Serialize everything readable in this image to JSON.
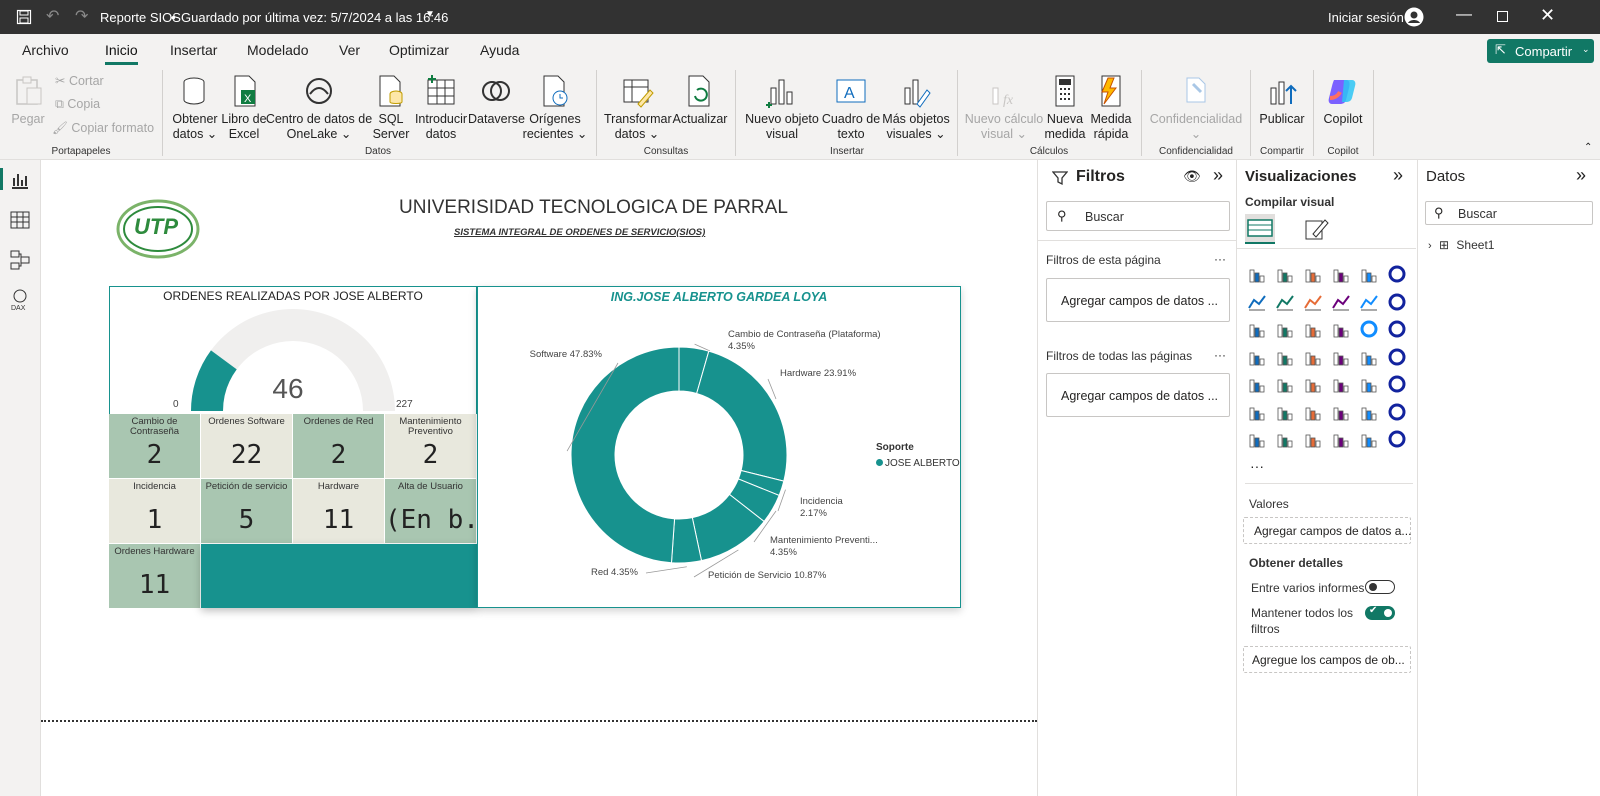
{
  "titlebar": {
    "title": "Reporte SIOS",
    "separator": "•",
    "saved": "Guardado por última vez: 5/7/2024 a las 16:46",
    "signin": "Iniciar sesión"
  },
  "menu": {
    "items": [
      "Archivo",
      "Inicio",
      "Insertar",
      "Modelado",
      "Ver",
      "Optimizar",
      "Ayuda"
    ],
    "share": "Compartir"
  },
  "ribbon": {
    "paste": "Pegar",
    "cut": "Cortar",
    "copy": "Copia",
    "format_painter": "Copiar formato",
    "get_data": [
      "Obtener",
      "datos ⌄"
    ],
    "excel": [
      "Libro de",
      "Excel"
    ],
    "onelake": [
      "Centro de datos de",
      "OneLake ⌄"
    ],
    "sql": [
      "SQL",
      "Server"
    ],
    "enter_data": [
      "Introducir",
      "datos"
    ],
    "dataverse": [
      "Dataverse"
    ],
    "recent": [
      "Orígenes",
      "recientes ⌄"
    ],
    "transform": [
      "Transformar",
      "datos ⌄"
    ],
    "refresh": [
      "Actualizar"
    ],
    "new_visual": [
      "Nuevo objeto",
      "visual"
    ],
    "textbox": [
      "Cuadro de",
      "texto"
    ],
    "more_visuals": [
      "Más objetos",
      "visuales ⌄"
    ],
    "new_calc": [
      "Nuevo cálculo",
      "visual ⌄"
    ],
    "new_measure": [
      "Nueva",
      "medida"
    ],
    "quick_measure": [
      "Medida",
      "rápida"
    ],
    "sensitivity": [
      "Confidencialidad",
      "⌄"
    ],
    "publish": [
      "Publicar"
    ],
    "copilot": [
      "Copilot"
    ],
    "groups": {
      "clipboard": "Portapapeles",
      "data": "Datos",
      "queries": "Consultas",
      "insert": "Insertar",
      "calcs": "Cálculos",
      "sens": "Confidencialidad",
      "share": "Compartir",
      "copilot": "Copilot"
    }
  },
  "report": {
    "title": "UNIVERISIDAD TECNOLOGICA DE PARRAL",
    "subtitle": "SISTEMA INTEGRAL DE ORDENES DE SERVICIO(SIOS)",
    "logo_text": "UTP",
    "gauge": {
      "title": "ORDENES REALIZADAS POR JOSE ALBERTO",
      "value": 46,
      "min": 0,
      "max": 227,
      "value_label": "46",
      "min_label": "0",
      "max_label": "227"
    },
    "tiles": [
      {
        "label": "Cambio de Contraseña",
        "value": "2",
        "color": "#a9c6b1"
      },
      {
        "label": "Ordenes Software",
        "value": "22",
        "color": "#e8e8dd"
      },
      {
        "label": "Ordenes de Red",
        "value": "2",
        "color": "#a9c6b1"
      },
      {
        "label": "Mantenimiento Preventivo",
        "value": "2",
        "color": "#e8e8dd"
      },
      {
        "label": "Incidencia",
        "value": "1",
        "color": "#e8e8dd"
      },
      {
        "label": "Petición de servicio",
        "value": "5",
        "color": "#a9c6b1"
      },
      {
        "label": "Hardware",
        "value": "11",
        "color": "#e8e8dd"
      },
      {
        "label": "Alta de Usuario",
        "value": "(En b...",
        "color": "#a9c6b1"
      },
      {
        "label": "Ordenes Hardware",
        "value": "11",
        "color": "#a9c6b1"
      }
    ],
    "donut_title": "ING.JOSE ALBERTO GARDEA LOYA",
    "legend": {
      "title": "Soporte",
      "item": "JOSE ALBERTO"
    },
    "accent": "#17928e"
  },
  "chart_data": {
    "type": "pie",
    "title": "ING.JOSE ALBERTO GARDEA LOYA",
    "legend_title": "Soporte",
    "series": [
      {
        "name": "JOSE ALBERTO"
      }
    ],
    "slices": [
      {
        "label": "Cambio de Contraseña (Plataforma)",
        "pct": 4.35,
        "text1": "Cambio de Contraseña (Plataforma)",
        "text2": "4.35%"
      },
      {
        "label": "Hardware",
        "pct": 23.91,
        "text1": "Hardware 23.91%",
        "text2": ""
      },
      {
        "label": "Incidencia",
        "pct": 2.17,
        "text1": "Incidencia",
        "text2": "2.17%"
      },
      {
        "label": "Mantenimiento Preventivo",
        "pct": 4.35,
        "text1": "Mantenimiento Preventi...",
        "text2": "4.35%"
      },
      {
        "label": "Petición de Servicio",
        "pct": 10.87,
        "text1": "Petición de Servicio 10.87%",
        "text2": ""
      },
      {
        "label": "Red",
        "pct": 4.35,
        "text1": "Red 4.35%",
        "text2": ""
      },
      {
        "label": "Software",
        "pct": 47.83,
        "text1": "Software 47.83%",
        "text2": ""
      }
    ],
    "color": "#17928e",
    "legend_position": "right"
  },
  "filters": {
    "title": "Filtros",
    "search": "Buscar",
    "page_filters": "Filtros de esta página",
    "all_filters": "Filtros de todas las páginas",
    "add_fields": "Agregar campos de datos ...",
    "more": "···"
  },
  "viz": {
    "title": "Visualizaciones",
    "build": "Compilar visual",
    "values": "Valores",
    "add_fields": "Agregar campos de datos a...",
    "drill": "Obtener detalles",
    "cross_report": "Entre varios informes",
    "keep_filters": [
      "Mantener todos los",
      "filtros"
    ],
    "add_drill": "Agregue los campos de ob...",
    "more": "···"
  },
  "datos": {
    "title": "Datos",
    "search": "Buscar",
    "table": "Sheet1"
  }
}
